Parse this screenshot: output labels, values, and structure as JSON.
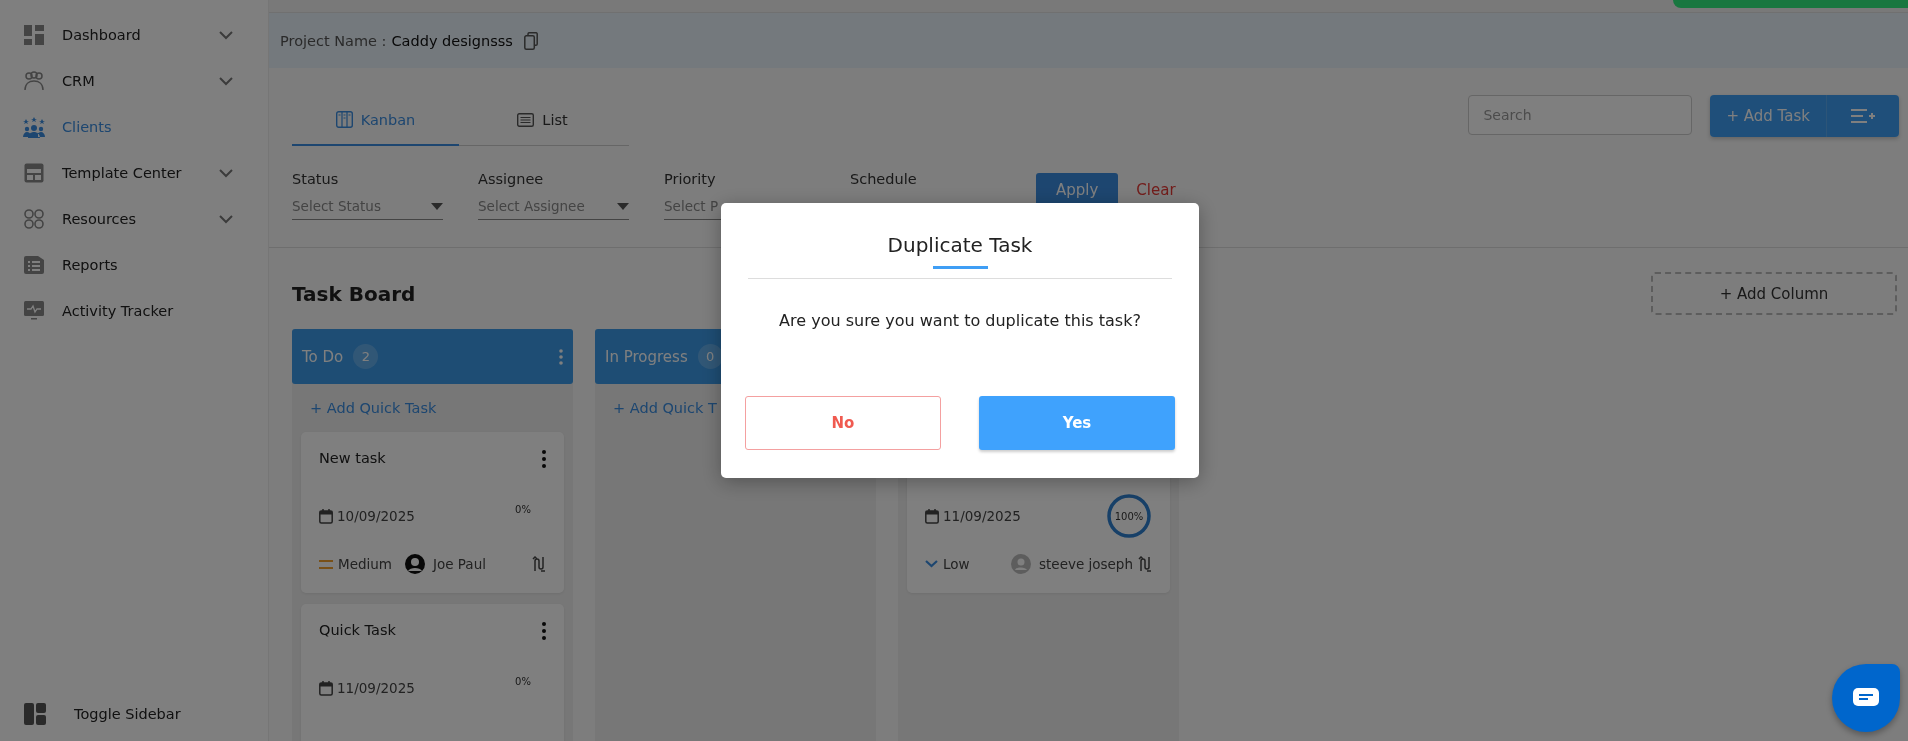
{
  "sidebar": {
    "items": [
      {
        "label": "Dashboard",
        "has_submenu": true,
        "selected": false
      },
      {
        "label": "CRM",
        "has_submenu": true,
        "selected": false
      },
      {
        "label": "Clients",
        "has_submenu": false,
        "selected": true
      },
      {
        "label": "Template Center",
        "has_submenu": true,
        "selected": false
      },
      {
        "label": "Resources",
        "has_submenu": true,
        "selected": false
      },
      {
        "label": "Reports",
        "has_submenu": false,
        "selected": false
      },
      {
        "label": "Activity Tracker",
        "has_submenu": false,
        "selected": false
      }
    ],
    "toggle": "Toggle Sidebar"
  },
  "project": {
    "label": "Project Name :",
    "name": "Caddy designsss"
  },
  "view_tabs": [
    {
      "label": "Kanban",
      "selected": true
    },
    {
      "label": "List",
      "selected": false
    }
  ],
  "search": {
    "placeholder": "Search"
  },
  "add_task_button": "+ Add Task",
  "filters": [
    {
      "label": "Status",
      "placeholder": "Select Status",
      "has_caret": true
    },
    {
      "label": "Assignee",
      "placeholder": "Select Assignee",
      "has_caret": true
    },
    {
      "label": "Priority",
      "placeholder": "Select P",
      "has_caret": false
    },
    {
      "label": "Schedule"
    }
  ],
  "apply_button": "Apply",
  "clear_button": "Clear",
  "board": {
    "title": "Task Board",
    "add_column": "+ Add Column",
    "columns": [
      {
        "title": "To Do",
        "count": "2",
        "quick_add": "+ Add Quick Task",
        "cards": [
          {
            "title": "New task",
            "date": "10/09/2025",
            "progress": "0%",
            "level": 0,
            "priority": "Medium",
            "priority_arrow": false,
            "assignee": "Joe Paul",
            "avatar_photo": true
          },
          {
            "title": "Quick Task",
            "date": "11/09/2025",
            "progress": "0%",
            "level": 0
          }
        ]
      },
      {
        "title": "In Progress",
        "count": "0",
        "quick_add": "+ Add Quick T"
      },
      {
        "cards": [
          {
            "date": "11/09/2025",
            "progress": "100%",
            "level": 1,
            "priority": "Low",
            "priority_arrow": true,
            "assignee": "steeve joseph",
            "avatar_photo": false
          }
        ]
      }
    ]
  },
  "dialog": {
    "title": "Duplicate Task",
    "message": "Are you sure you want to duplicate this task?",
    "buttons": [
      {
        "label": "No",
        "kind": "cancel"
      },
      {
        "label": "Yes",
        "kind": "confirm"
      }
    ]
  }
}
